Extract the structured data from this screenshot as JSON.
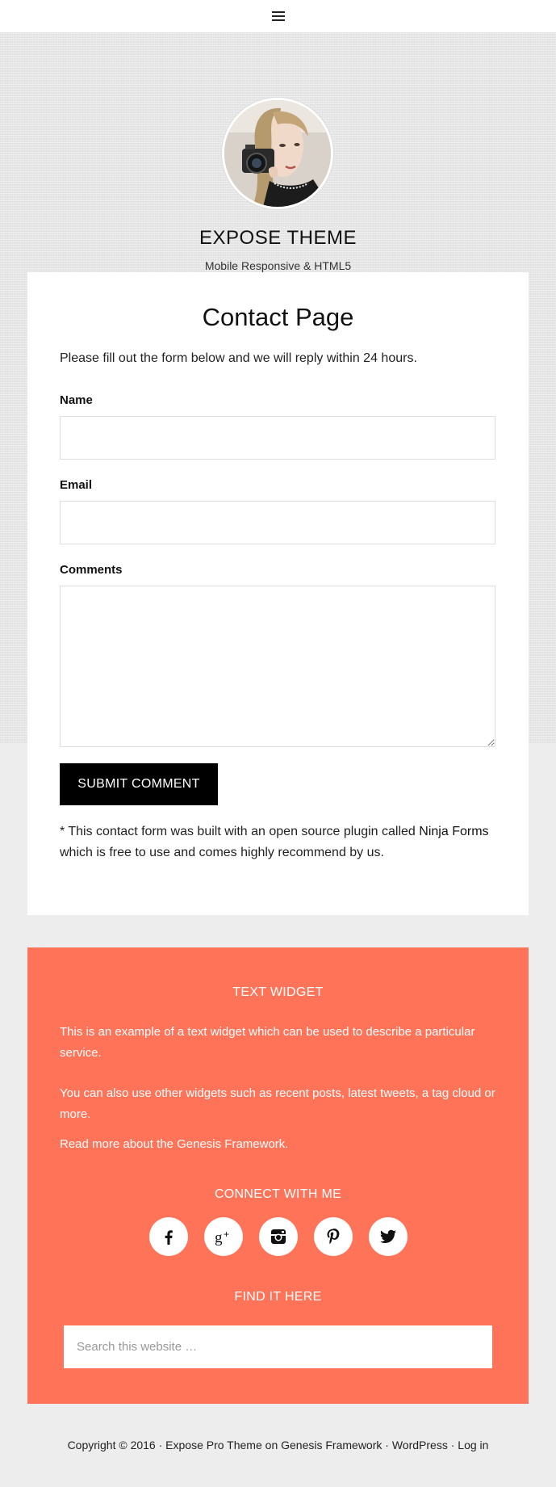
{
  "header": {
    "menu_icon": "hamburger-menu-icon"
  },
  "site": {
    "avatar_icon": "photographer-avatar",
    "title": "EXPOSE THEME",
    "description": "Mobile Responsive & HTML5"
  },
  "page": {
    "title": "Contact Page",
    "intro": "Please fill out the form below and we will reply within 24 hours.",
    "form": {
      "name_label": "Name",
      "name_value": "",
      "email_label": "Email",
      "email_value": "",
      "comments_label": "Comments",
      "comments_value": "",
      "submit_label": "SUBMIT COMMENT"
    },
    "note": {
      "prefix": "* This contact form was built with an open source plugin called ",
      "link": "Ninja Forms",
      "suffix": " which is free to use and comes highly recommend by us."
    }
  },
  "widgets": {
    "text_widget": {
      "title": "TEXT WIDGET",
      "paragraph1": "This is an example of a text widget which can be used to describe a particular service.",
      "paragraph2": "You can also use other widgets such as recent posts, latest tweets, a tag cloud or more.",
      "link": "Read more about the Genesis Framework."
    },
    "connect": {
      "title": "CONNECT WITH ME",
      "icons": [
        "facebook-icon",
        "google-plus-icon",
        "instagram-icon",
        "pinterest-icon",
        "twitter-icon"
      ]
    },
    "find": {
      "title": "FIND IT HERE",
      "search_placeholder": "Search this website …"
    },
    "accent_color": "#ff7359"
  },
  "footer": {
    "copyright": "Copyright © 2016 · ",
    "theme_link": "Expose Pro Theme",
    "on": " on ",
    "genesis_link": "Genesis Framework",
    "sep1": " · ",
    "wp_link": "WordPress",
    "sep2": " · ",
    "login_link": "Log in"
  }
}
